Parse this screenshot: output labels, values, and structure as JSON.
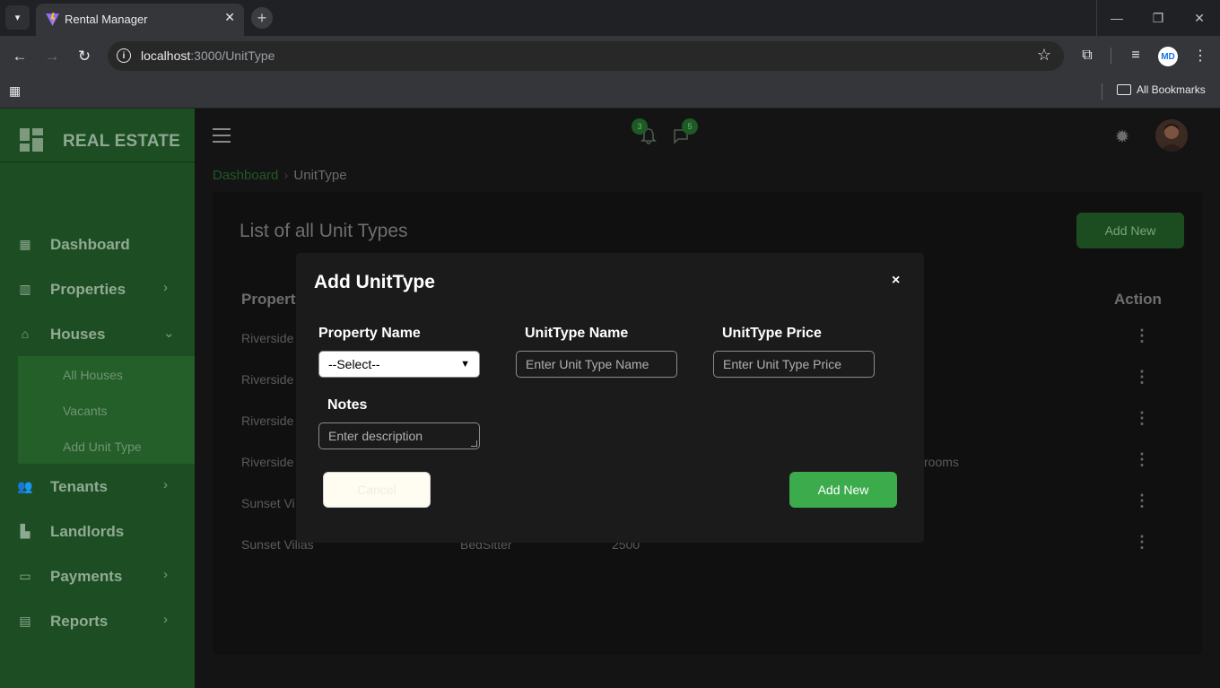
{
  "browser": {
    "tab_title": "Rental Manager",
    "url_host": "localhost",
    "url_path": ":3000/UnitType",
    "bookmarks_label": "All Bookmarks",
    "profile_initials": "MD"
  },
  "sidebar": {
    "brand": "REAL ESTATE",
    "items": [
      {
        "label": "Dashboard",
        "icon": "dashboard-icon"
      },
      {
        "label": "Properties",
        "icon": "building-icon"
      },
      {
        "label": "Houses",
        "icon": "home-icon"
      },
      {
        "label": "Tenants",
        "icon": "users-icon"
      },
      {
        "label": "Landlords",
        "icon": "landlord-icon"
      },
      {
        "label": "Payments",
        "icon": "payment-card-icon"
      },
      {
        "label": "Reports",
        "icon": "report-icon"
      }
    ],
    "houses_submenu": [
      "All Houses",
      "Vacants",
      "Add Unit Type"
    ]
  },
  "topbar": {
    "notification_count": "3",
    "message_count": "5"
  },
  "breadcrumb": {
    "home": "Dashboard",
    "current": "UnitType"
  },
  "page": {
    "title": "List of all Unit Types",
    "add_button": "Add New"
  },
  "table": {
    "headers": {
      "property": "Property",
      "action": "Action"
    },
    "rows": [
      {
        "property": "Riverside"
      },
      {
        "property": "Riverside"
      },
      {
        "property": "Riverside"
      },
      {
        "property": "Riverside",
        "notes_tail": "rooms"
      },
      {
        "property": "Sunset Vi"
      },
      {
        "property": "Sunset Villas",
        "unit_type": "BedSitter",
        "price": "2500"
      }
    ]
  },
  "modal": {
    "title": "Add UnitType",
    "close": "×",
    "property_label": "Property Name",
    "property_selected": "--Select--",
    "unit_name_label": "UnitType Name",
    "unit_name_placeholder": "Enter Unit Type Name",
    "unit_price_label": "UnitType Price",
    "unit_price_placeholder": "Enter Unit Type Price",
    "notes_label": "Notes",
    "notes_placeholder": "Enter description",
    "cancel_label": "Cancel",
    "submit_label": "Add New"
  },
  "colors": {
    "sidebar_bg": "#1d4d22",
    "accent_green": "#3cab4c",
    "modal_bg": "#1b1b1b"
  }
}
